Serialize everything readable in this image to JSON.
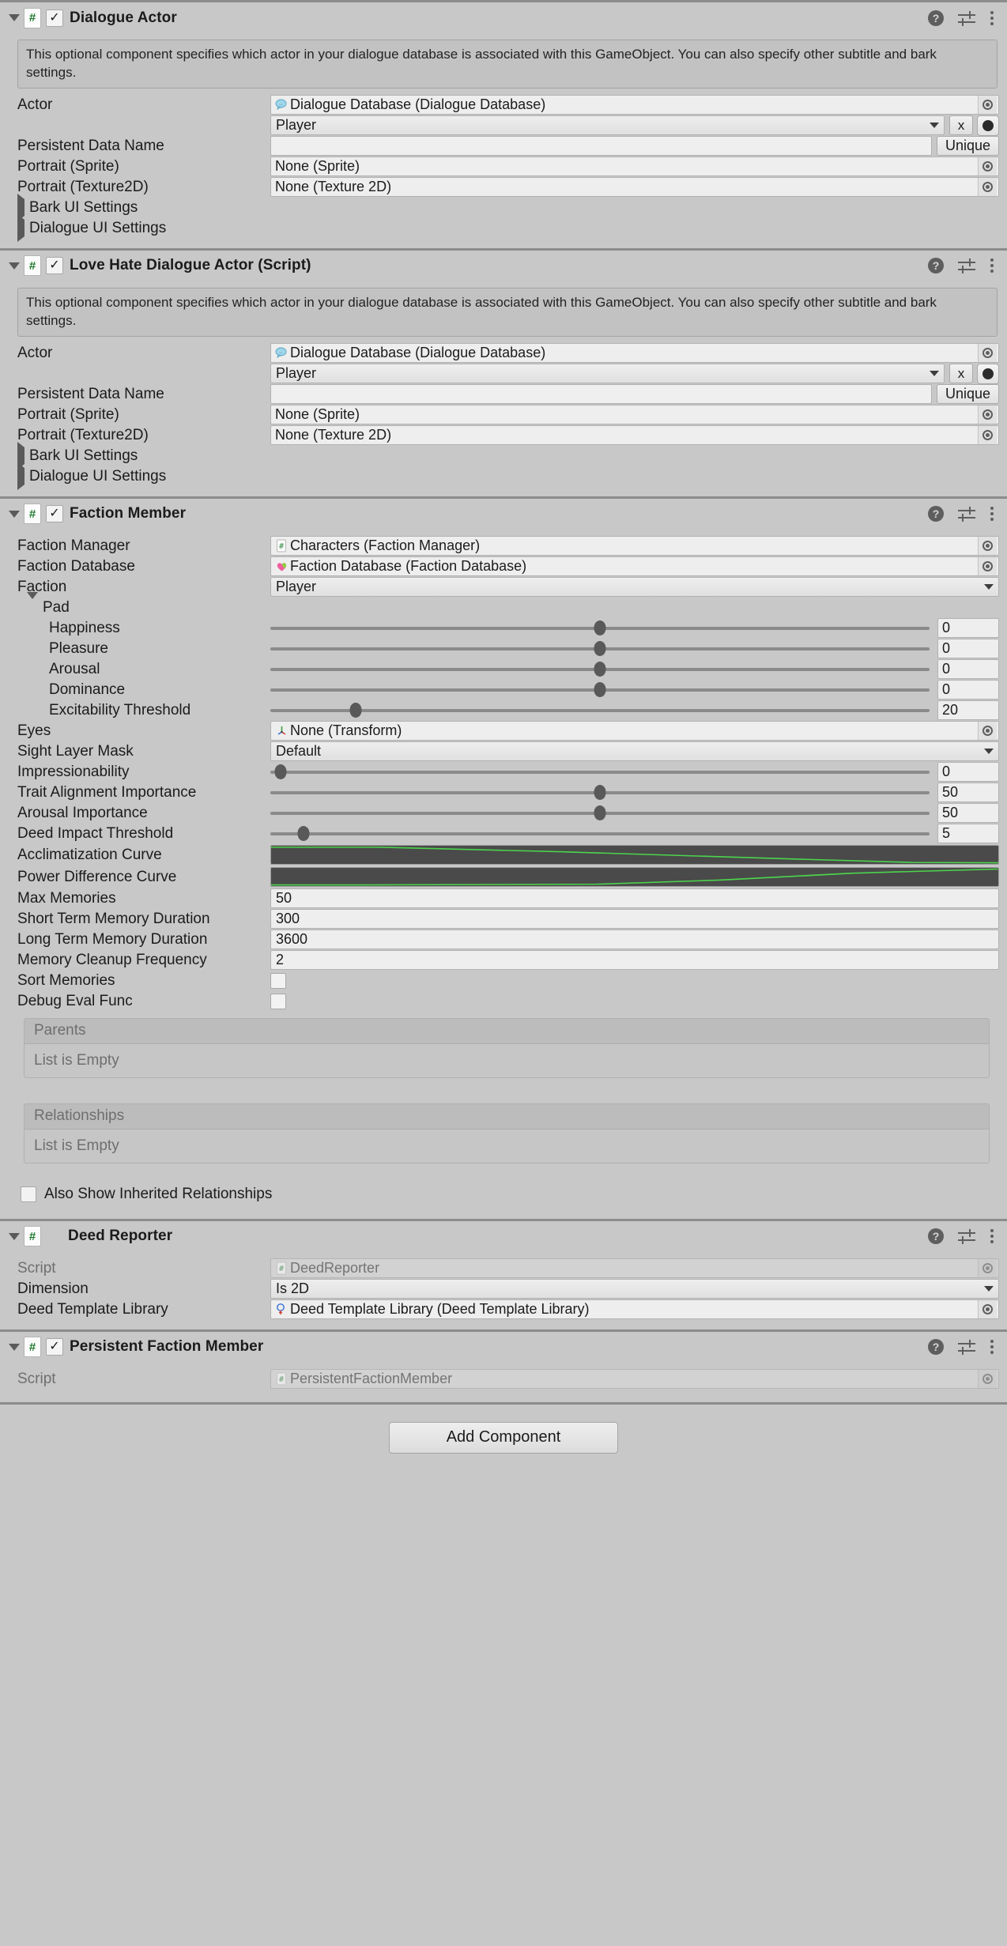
{
  "icons": {
    "help": "?",
    "check": "✓",
    "hash": "#",
    "x": "x",
    "dots": "three-dots"
  },
  "components": [
    {
      "id": "dialogue-actor",
      "title": "Dialogue Actor",
      "has_checkbox": true,
      "checked": true,
      "expanded": true,
      "help_text": "This optional component specifies which actor in your dialogue database is associated with this GameObject. You can also specify other subtitle and bark settings.",
      "rows": {
        "actor_label": "Actor",
        "actor_object": "Dialogue Database (Dialogue Database)",
        "actor_dropdown": "Player",
        "clear_button": "x",
        "persistent_label": "Persistent Data Name",
        "persistent_value": "",
        "unique_button": "Unique",
        "portrait_sprite_label": "Portrait (Sprite)",
        "portrait_sprite_value": "None (Sprite)",
        "portrait_tex_label": "Portrait (Texture2D)",
        "portrait_tex_value": "None (Texture 2D)",
        "bark_ui": "Bark UI Settings",
        "dialogue_ui": "Dialogue UI Settings"
      }
    },
    {
      "id": "love-hate-dialogue-actor",
      "title": "Love Hate Dialogue Actor (Script)",
      "has_checkbox": true,
      "checked": true,
      "expanded": true,
      "help_text": "This optional component specifies which actor in your dialogue database is associated with this GameObject. You can also specify other subtitle and bark settings.",
      "rows": {
        "actor_label": "Actor",
        "actor_object": "Dialogue Database (Dialogue Database)",
        "actor_dropdown": "Player",
        "clear_button": "x",
        "persistent_label": "Persistent Data Name",
        "persistent_value": "",
        "unique_button": "Unique",
        "portrait_sprite_label": "Portrait (Sprite)",
        "portrait_sprite_value": "None (Sprite)",
        "portrait_tex_label": "Portrait (Texture2D)",
        "portrait_tex_value": "None (Texture 2D)",
        "bark_ui": "Bark UI Settings",
        "dialogue_ui": "Dialogue UI Settings"
      }
    }
  ],
  "faction_member": {
    "title": "Faction Member",
    "has_checkbox": true,
    "checked": true,
    "expanded": true,
    "faction_manager_label": "Faction Manager",
    "faction_manager_value": "Characters (Faction Manager)",
    "faction_database_label": "Faction Database",
    "faction_database_value": "Faction Database (Faction Database)",
    "faction_label": "Faction",
    "faction_value": "Player",
    "pad_label": "Pad",
    "pad_sliders": [
      {
        "label": "Happiness",
        "value": "0",
        "pct": 50
      },
      {
        "label": "Pleasure",
        "value": "0",
        "pct": 50
      },
      {
        "label": "Arousal",
        "value": "0",
        "pct": 50
      },
      {
        "label": "Dominance",
        "value": "0",
        "pct": 50
      },
      {
        "label": "Excitability Threshold",
        "value": "20",
        "pct": 13
      }
    ],
    "eyes_label": "Eyes",
    "eyes_value": "None (Transform)",
    "sight_layer_mask_label": "Sight Layer Mask",
    "sight_layer_mask_value": "Default",
    "sliders": [
      {
        "label": "Impressionability",
        "value": "0",
        "pct": 1
      },
      {
        "label": "Trait Alignment Importance",
        "value": "50",
        "pct": 50
      },
      {
        "label": "Arousal Importance",
        "value": "50",
        "pct": 50
      },
      {
        "label": "Deed Impact Threshold",
        "value": "5",
        "pct": 5
      }
    ],
    "acclimatization_curve_label": "Acclimatization Curve",
    "power_difference_curve_label": "Power Difference Curve",
    "fields": [
      {
        "label": "Max Memories",
        "value": "50"
      },
      {
        "label": "Short Term Memory Duration",
        "value": "300"
      },
      {
        "label": "Long Term Memory Duration",
        "value": "3600"
      },
      {
        "label": "Memory Cleanup Frequency",
        "value": "2"
      }
    ],
    "checkboxes": [
      {
        "label": "Sort Memories",
        "checked": false
      },
      {
        "label": "Debug Eval Func",
        "checked": false
      }
    ],
    "parents_list": {
      "header": "Parents",
      "empty_text": "List is Empty"
    },
    "relationships_list": {
      "header": "Relationships",
      "empty_text": "List is Empty"
    },
    "inherited_label": "Also Show Inherited Relationships",
    "inherited_checked": false
  },
  "deed_reporter": {
    "title": "Deed Reporter",
    "has_checkbox": false,
    "expanded": true,
    "script_label": "Script",
    "script_value": "DeedReporter",
    "dimension_label": "Dimension",
    "dimension_value": "Is 2D",
    "library_label": "Deed Template Library",
    "library_value": "Deed Template Library (Deed Template Library)"
  },
  "persistent_faction_member": {
    "title": "Persistent Faction Member",
    "has_checkbox": true,
    "checked": true,
    "expanded": true,
    "script_label": "Script",
    "script_value": "PersistentFactionMember"
  },
  "footer": {
    "add_component_label": "Add Component"
  },
  "chart_data": {
    "type": "line",
    "title": "Acclimatization / Power Difference Curves",
    "series": [
      {
        "name": "Acclimatization Curve",
        "x": [
          0,
          0.15,
          1.0
        ],
        "y": [
          1.0,
          1.0,
          0.0
        ]
      },
      {
        "name": "Power Difference Curve",
        "x": [
          0,
          0.15,
          0.45,
          1.0
        ],
        "y": [
          0.0,
          0.0,
          0.0,
          1.0
        ]
      }
    ],
    "xlabel": "",
    "ylabel": "",
    "xlim": [
      0,
      1
    ],
    "ylim": [
      0,
      1
    ],
    "grid": false,
    "legend": "none",
    "line_color": "#4cd44c",
    "background": "#4a4a4a"
  }
}
